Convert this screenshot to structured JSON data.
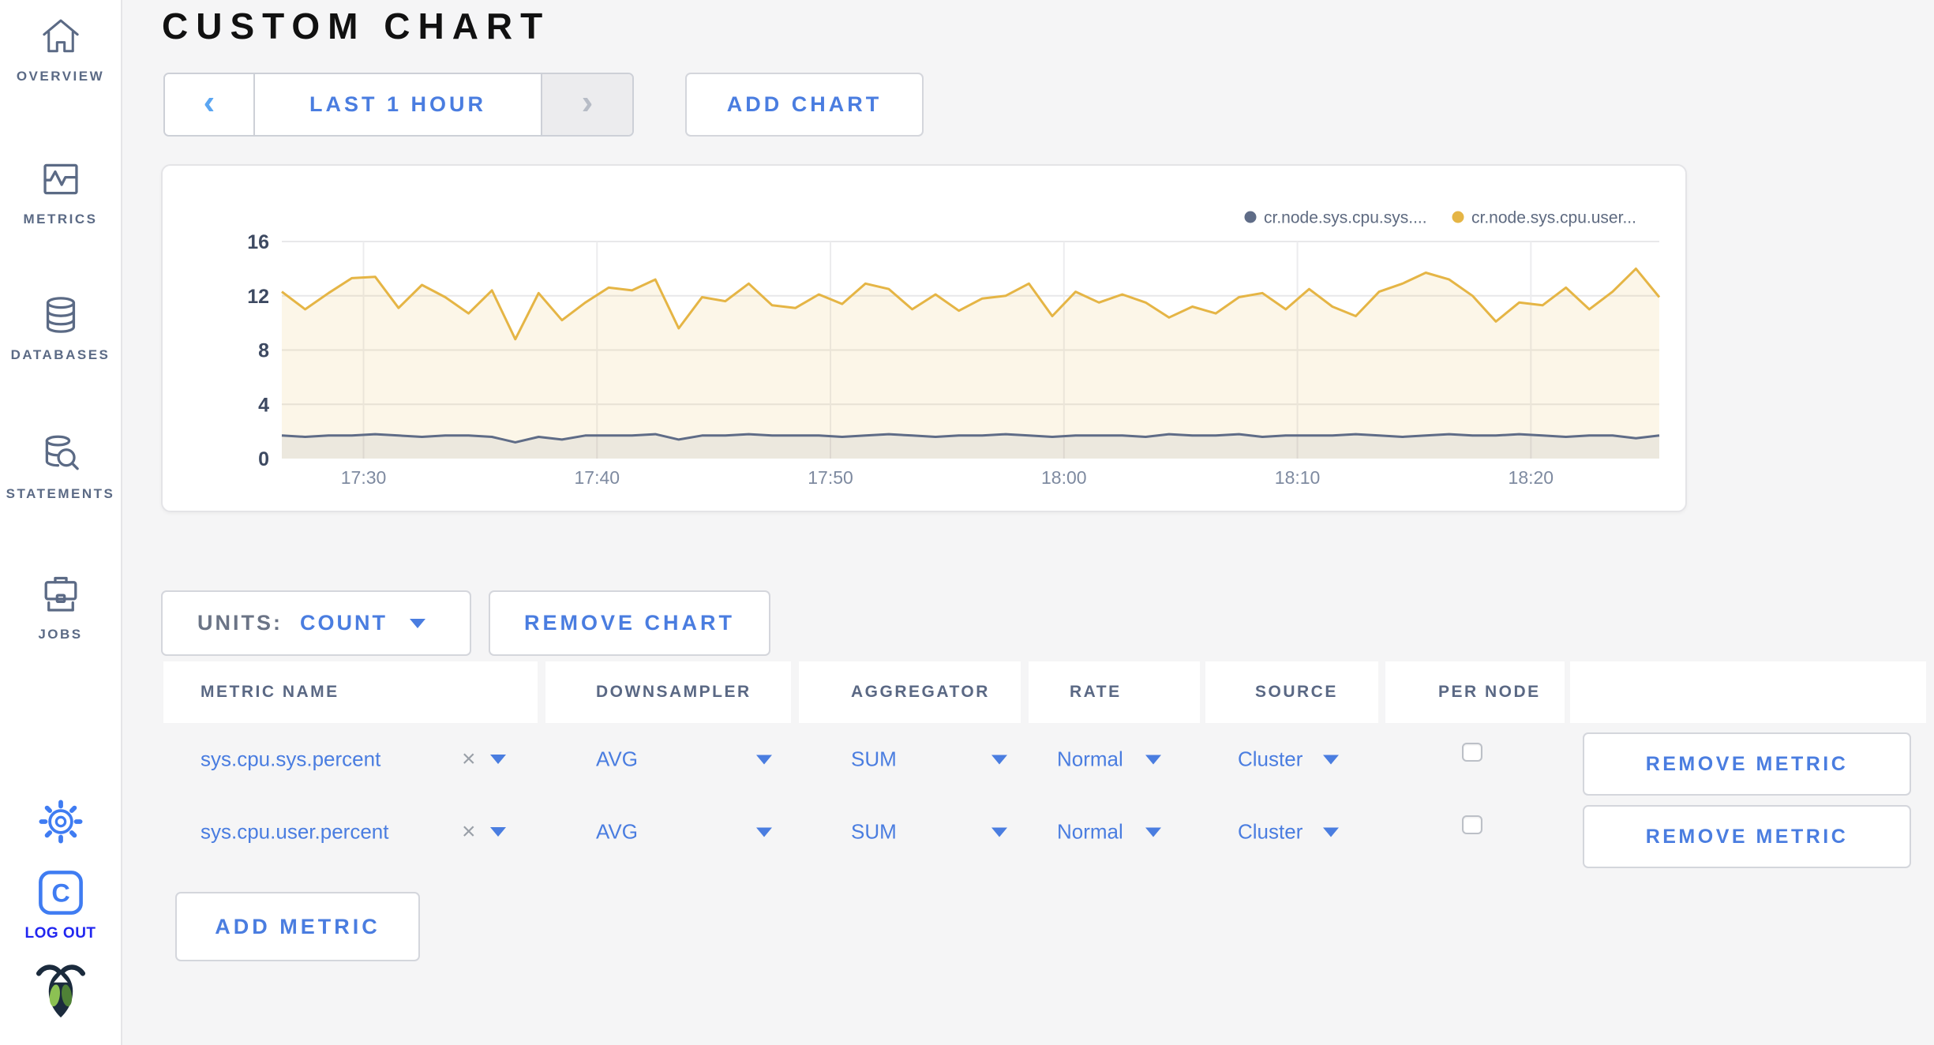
{
  "sidebar": {
    "items": [
      {
        "label": "OVERVIEW"
      },
      {
        "label": "METRICS"
      },
      {
        "label": "DATABASES"
      },
      {
        "label": "STATEMENTS"
      },
      {
        "label": "JOBS"
      }
    ],
    "logout_label": "LOG OUT"
  },
  "header": {
    "title": "CUSTOM CHART",
    "time_range_label": "LAST 1 HOUR",
    "prev_arrow": "‹",
    "next_arrow": "›",
    "add_chart_label": "ADD CHART"
  },
  "chart_data": {
    "type": "line",
    "title": "",
    "xlabel": "",
    "ylabel": "",
    "ylim": [
      0,
      16
    ],
    "y_ticks": [
      0,
      4,
      8,
      12,
      16
    ],
    "x_span_minutes": 59,
    "x_ticks": [
      {
        "label": "17:30",
        "t": 3.5
      },
      {
        "label": "17:40",
        "t": 13.5
      },
      {
        "label": "17:50",
        "t": 23.5
      },
      {
        "label": "18:00",
        "t": 33.5
      },
      {
        "label": "18:10",
        "t": 43.5
      },
      {
        "label": "18:20",
        "t": 53.5
      }
    ],
    "legend_position": "top-right",
    "grid": true,
    "series": [
      {
        "name": "cr.node.sys.cpu.sys....",
        "color": "#5f6c87",
        "fill": "rgba(95,108,135,0.10)",
        "values": [
          1.7,
          1.6,
          1.7,
          1.7,
          1.8,
          1.7,
          1.6,
          1.7,
          1.7,
          1.6,
          1.2,
          1.6,
          1.4,
          1.7,
          1.7,
          1.7,
          1.8,
          1.4,
          1.7,
          1.7,
          1.8,
          1.7,
          1.7,
          1.7,
          1.6,
          1.7,
          1.8,
          1.7,
          1.6,
          1.7,
          1.7,
          1.8,
          1.7,
          1.6,
          1.7,
          1.7,
          1.7,
          1.6,
          1.8,
          1.7,
          1.7,
          1.8,
          1.6,
          1.7,
          1.7,
          1.7,
          1.8,
          1.7,
          1.6,
          1.7,
          1.8,
          1.7,
          1.7,
          1.8,
          1.7,
          1.6,
          1.7,
          1.7,
          1.5,
          1.7
        ]
      },
      {
        "name": "cr.node.sys.cpu.user...",
        "color": "#e5b545",
        "fill": "rgba(232,184,74,0.13)",
        "values": [
          12.3,
          11.0,
          12.2,
          13.3,
          13.4,
          11.1,
          12.8,
          11.9,
          10.7,
          12.4,
          8.8,
          12.2,
          10.2,
          11.5,
          12.6,
          12.4,
          13.2,
          9.6,
          11.9,
          11.6,
          12.9,
          11.3,
          11.1,
          12.1,
          11.4,
          12.9,
          12.5,
          11.0,
          12.1,
          10.9,
          11.8,
          12.0,
          12.9,
          10.5,
          12.3,
          11.5,
          12.1,
          11.5,
          10.4,
          11.2,
          10.7,
          11.9,
          12.2,
          11.0,
          12.5,
          11.2,
          10.5,
          12.3,
          12.9,
          13.7,
          13.2,
          12.0,
          10.1,
          11.5,
          11.3,
          12.6,
          11.0,
          12.3,
          14.0,
          11.9
        ]
      }
    ]
  },
  "controls": {
    "units_label": "UNITS:",
    "units_value": "COUNT",
    "remove_chart_label": "REMOVE CHART",
    "add_metric_label": "ADD METRIC",
    "remove_metric_label": "REMOVE METRIC"
  },
  "table": {
    "headers": [
      "METRIC NAME",
      "DOWNSAMPLER",
      "AGGREGATOR",
      "RATE",
      "SOURCE",
      "PER NODE",
      ""
    ],
    "rows": [
      {
        "metric": "sys.cpu.sys.percent",
        "downsampler": "AVG",
        "aggregator": "SUM",
        "rate": "Normal",
        "source": "Cluster",
        "per_node": false
      },
      {
        "metric": "sys.cpu.user.percent",
        "downsampler": "AVG",
        "aggregator": "SUM",
        "rate": "Normal",
        "source": "Cluster",
        "per_node": false
      }
    ]
  }
}
